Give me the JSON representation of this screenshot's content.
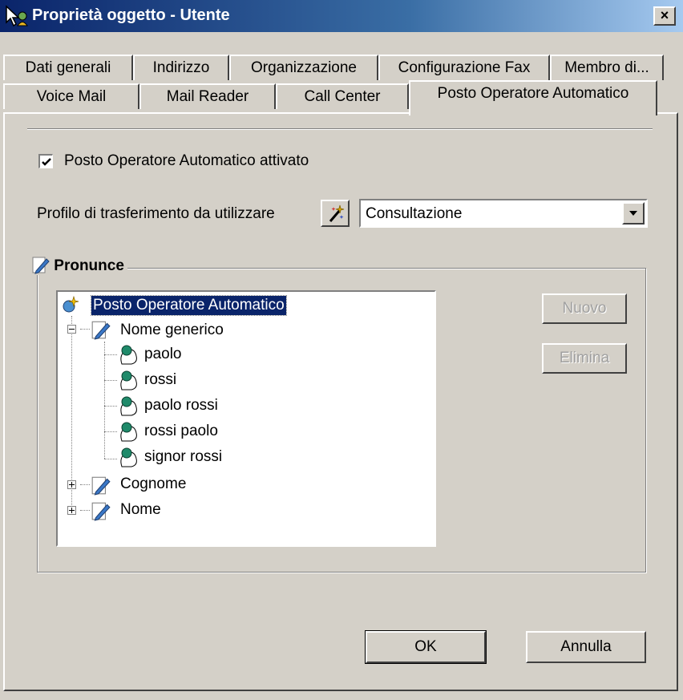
{
  "window": {
    "title": "Proprietà oggetto - Utente",
    "close_label": "×"
  },
  "tabs": {
    "row1": [
      {
        "label": "Dati generali"
      },
      {
        "label": "Indirizzo"
      },
      {
        "label": "Organizzazione"
      },
      {
        "label": "Configurazione Fax"
      },
      {
        "label": "Membro di..."
      }
    ],
    "row2": [
      {
        "label": "Voice Mail"
      },
      {
        "label": "Mail Reader"
      },
      {
        "label": "Call Center"
      },
      {
        "label": "Posto Operatore Automatico",
        "active": true
      }
    ]
  },
  "settings": {
    "enabled_label": "Posto Operatore Automatico attivato",
    "enabled_checked": true,
    "profile_label": "Profilo di trasferimento da utilizzare",
    "profile_value": "Consultazione"
  },
  "pronunce": {
    "group_title": "Pronunce",
    "tree": {
      "root": "Posto Operatore Automatico",
      "nome_generico": "Nome generico",
      "children": [
        "paolo",
        "rossi",
        "paolo rossi",
        "rossi paolo",
        "signor rossi"
      ],
      "cognome": "Cognome",
      "nome": "Nome"
    },
    "new_button": "Nuovo",
    "delete_button": "Elimina"
  },
  "footer": {
    "ok_label": "OK",
    "cancel_label": "Annulla"
  },
  "icons": {
    "app": "user-properties-icon",
    "wand": "wand-icon",
    "pencil": "pencil-icon",
    "head": "speaking-head-icon"
  }
}
